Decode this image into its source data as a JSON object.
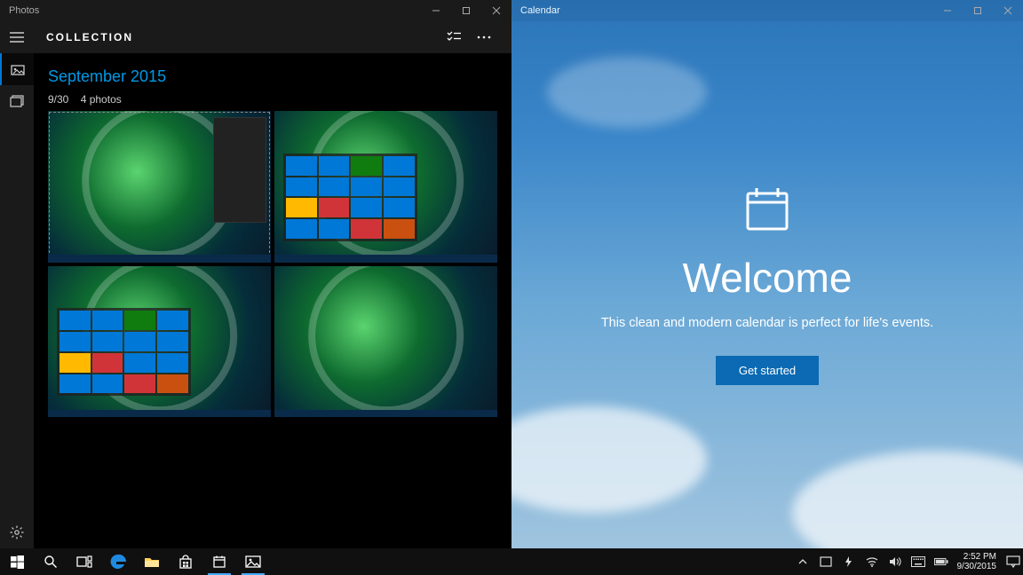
{
  "photos": {
    "title": "Photos",
    "header": "COLLECTION",
    "month": "September 2015",
    "day": "9/30",
    "count": "4 photos"
  },
  "calendar": {
    "title": "Calendar",
    "welcome": "Welcome",
    "subtitle": "This clean and modern calendar is perfect for life's events.",
    "cta": "Get started"
  },
  "taskbar": {
    "time": "2:52 PM",
    "date": "9/30/2015"
  }
}
